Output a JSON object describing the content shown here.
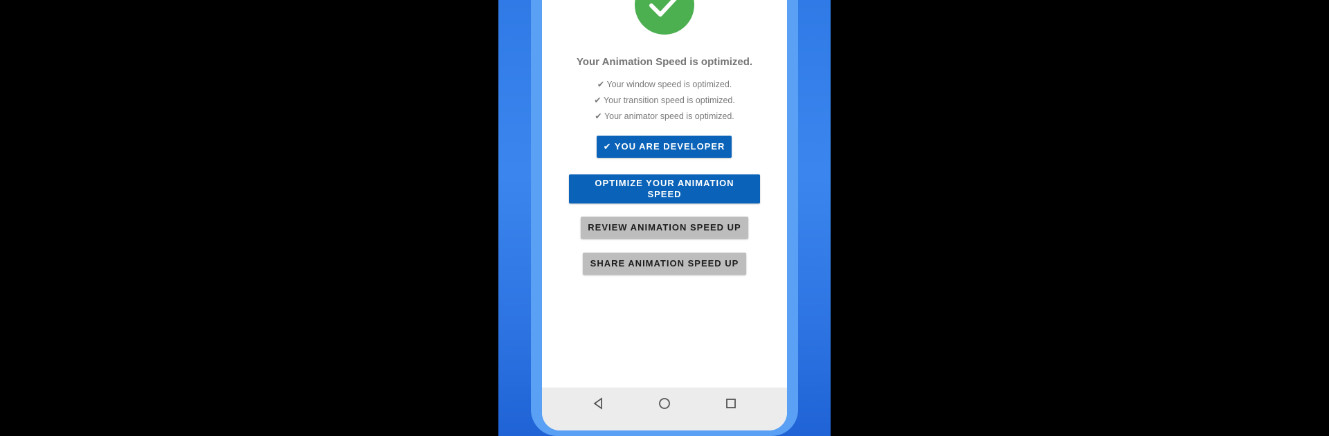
{
  "app": {
    "headline": "Your Animation Speed is optimized.",
    "status_lines": [
      "✔ Your window speed is optimized.",
      "✔ Your transition speed is optimized.",
      "✔ Your animator speed is optimized."
    ],
    "buttons": {
      "developer": "✔ YOU ARE DEVELOPER",
      "optimize": "OPTIMIZE YOUR ANIMATION SPEED",
      "review": "REVIEW ANIMATION SPEED UP",
      "share": "SHARE ANIMATION SPEED UP"
    }
  },
  "navigation": {
    "icons": [
      "back-icon",
      "home-icon",
      "recents-icon"
    ]
  },
  "colors": {
    "background": "#000000",
    "promo_blue": "#2f7ae6",
    "frame_blue": "#5aa0f4",
    "success_green": "#4caf50",
    "primary_button": "#0a63b8",
    "secondary_button": "#bdbdbd"
  }
}
